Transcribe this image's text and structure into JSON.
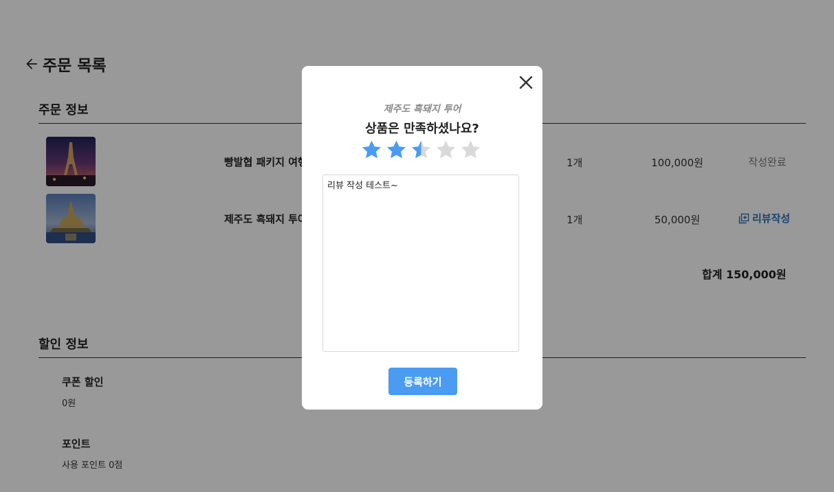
{
  "page": {
    "title": "주문 목록"
  },
  "order_info": {
    "section_title": "주문 정보",
    "items": [
      {
        "name": "빵발협 패키지 여행",
        "quantity": "1개",
        "price": "100,000원",
        "review_status": "작성완료"
      },
      {
        "name": "제주도 흑돼지 투어",
        "quantity": "1개",
        "price": "50,000원",
        "review_action": "리뷰작성"
      }
    ],
    "total": "합계 150,000원"
  },
  "discount_info": {
    "section_title": "할인 정보",
    "coupon": {
      "label": "쿠폰 할인",
      "value": "0원"
    },
    "points": {
      "label": "포인트",
      "value": "사용 포인트 0점"
    }
  },
  "review_modal": {
    "product_name": "제주도 흑돼지 투어",
    "question": "상품은 만족하셨나요?",
    "rating": 2.5,
    "rating_max": 5,
    "review_text": "리뷰 작성 테스트~",
    "submit_label": "등록하기",
    "colors": {
      "star_filled": "#4a9cf3",
      "star_empty": "#d9d9d9",
      "submit_bg": "#4a9cf3"
    }
  },
  "icons": {
    "back": "arrow-left-icon",
    "close": "close-icon",
    "review": "review-add-icon",
    "star": "star-icon"
  }
}
